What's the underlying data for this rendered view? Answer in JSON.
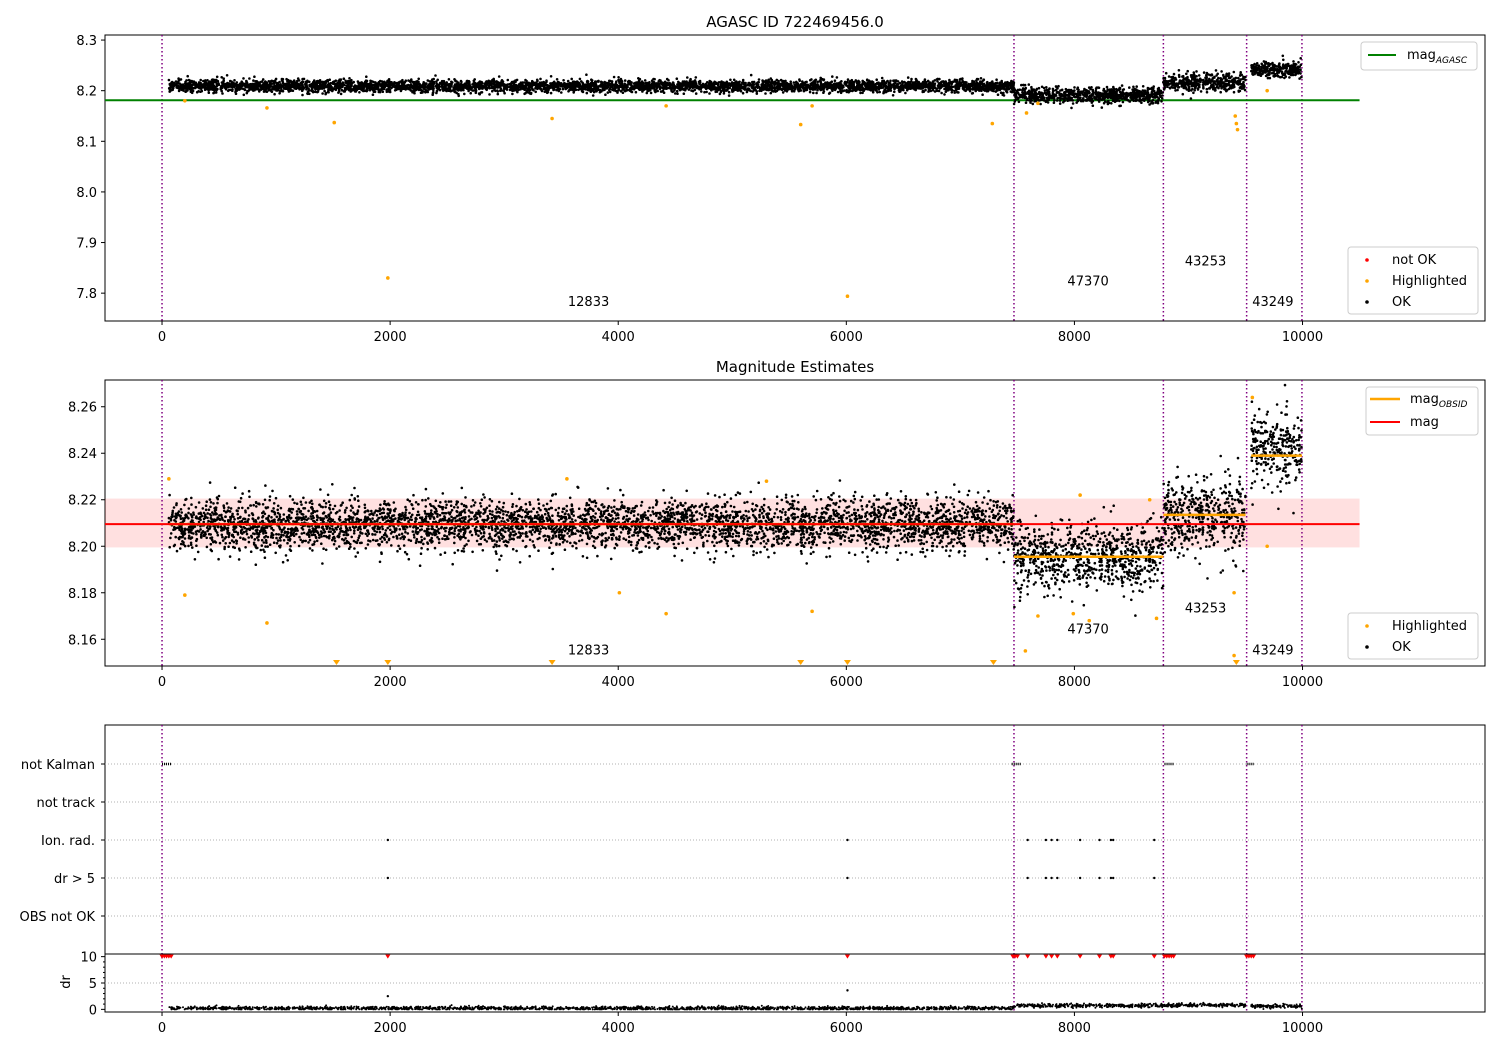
{
  "chart_data": [
    {
      "type": "scatter",
      "title": "AGASC ID 722469456.0",
      "xlim": [
        -500,
        11600
      ],
      "ylim": [
        7.745,
        8.31
      ],
      "xticks": [
        0,
        2000,
        4000,
        6000,
        8000,
        10000
      ],
      "yticks": [
        7.8,
        7.9,
        8.0,
        8.1,
        8.2,
        8.3
      ],
      "obs_boundaries": [
        0,
        7470,
        8780,
        9510,
        9995
      ],
      "obs_labels": [
        {
          "text": "12833",
          "x": 3740,
          "y": 7.775
        },
        {
          "text": "47370",
          "x": 8120,
          "y": 7.815
        },
        {
          "text": "43253",
          "x": 9150,
          "y": 7.855
        },
        {
          "text": "43249",
          "x": 9740,
          "y": 7.775
        }
      ],
      "reference_lines": [
        {
          "name": "mag_AGASC",
          "y": 8.181,
          "x": [
            -500,
            10500
          ],
          "color": "#008000"
        }
      ],
      "bands": [
        {
          "x": [
            60,
            7470
          ],
          "center": 8.209,
          "spread": 0.006
        },
        {
          "x": [
            7470,
            8780
          ],
          "center": 8.191,
          "spread": 0.008
        },
        {
          "x": [
            8780,
            9500
          ],
          "center": 8.216,
          "spread": 0.009
        },
        {
          "x": [
            9550,
            9995
          ],
          "center": 8.242,
          "spread": 0.008
        }
      ],
      "highlighted_points": [
        [
          1510,
          8.137
        ],
        [
          1980,
          7.83
        ],
        [
          3420,
          8.145
        ],
        [
          5600,
          8.133
        ],
        [
          6010,
          7.794
        ],
        [
          7280,
          8.135
        ],
        [
          7580,
          8.156
        ],
        [
          7680,
          8.175
        ],
        [
          9410,
          8.15
        ],
        [
          9420,
          8.135
        ],
        [
          9430,
          8.123
        ],
        [
          9690,
          8.2
        ],
        [
          200,
          8.18
        ],
        [
          920,
          8.166
        ],
        [
          4420,
          8.17
        ],
        [
          5700,
          8.17
        ]
      ],
      "legend": [
        "not OK",
        "Highlighted",
        "OK"
      ],
      "legend_top": [
        "mag_AGASC"
      ],
      "colors": {
        "ok": "#000000",
        "highlighted": "#ffa500",
        "not_ok": "#ff0000",
        "agasc_line": "#008000"
      }
    },
    {
      "type": "scatter",
      "title": "Magnitude Estimates",
      "xlim": [
        -500,
        11600
      ],
      "ylim": [
        8.1485,
        8.2715
      ],
      "xticks": [
        0,
        2000,
        4000,
        6000,
        8000,
        10000
      ],
      "yticks": [
        8.16,
        8.18,
        8.2,
        8.22,
        8.24,
        8.26
      ],
      "obs_boundaries": [
        0,
        7470,
        8780,
        9510,
        9995
      ],
      "obs_labels": [
        {
          "text": "12833",
          "x": 3740,
          "y": 8.1535
        },
        {
          "text": "47370",
          "x": 8120,
          "y": 8.1625
        },
        {
          "text": "43253",
          "x": 9150,
          "y": 8.1715
        },
        {
          "text": "43249",
          "x": 9740,
          "y": 8.1535
        }
      ],
      "mag": {
        "y": 8.2095,
        "x": [
          -500,
          10500
        ],
        "band": [
          8.1995,
          8.2205
        ],
        "color": "#ff0000"
      },
      "mag_obsid": [
        {
          "x": [
            60,
            7470
          ],
          "y": 8.2095
        },
        {
          "x": [
            7470,
            8780
          ],
          "y": 8.1955
        },
        {
          "x": [
            8780,
            9500
          ],
          "y": 8.2135
        },
        {
          "x": [
            9550,
            9995
          ],
          "y": 8.239
        }
      ],
      "bands": [
        {
          "x": [
            60,
            7470
          ],
          "center": 8.2095,
          "spread": 0.0055
        },
        {
          "x": [
            7470,
            8780
          ],
          "center": 8.1955,
          "spread": 0.0075
        },
        {
          "x": [
            8780,
            9500
          ],
          "center": 8.2135,
          "spread": 0.0085
        },
        {
          "x": [
            9550,
            9995
          ],
          "center": 8.241,
          "spread": 0.0075
        }
      ],
      "highlighted_points": [
        [
          200,
          8.179
        ],
        [
          920,
          8.167
        ],
        [
          4010,
          8.18
        ],
        [
          4420,
          8.171
        ],
        [
          5700,
          8.172
        ],
        [
          7570,
          8.155
        ],
        [
          7680,
          8.17
        ],
        [
          7990,
          8.171
        ],
        [
          8130,
          8.168
        ],
        [
          8720,
          8.169
        ],
        [
          9400,
          8.18
        ],
        [
          9400,
          8.153
        ],
        [
          9690,
          8.2
        ],
        [
          9560,
          8.264
        ],
        [
          60,
          8.229
        ],
        [
          3550,
          8.229
        ],
        [
          5300,
          8.228
        ],
        [
          8050,
          8.222
        ],
        [
          8660,
          8.22
        ]
      ],
      "clipped_points": [
        1530,
        1980,
        3420,
        5600,
        6010,
        7290,
        9420
      ],
      "legend": [
        "Highlighted",
        "OK"
      ],
      "legend_top": [
        "mag_OBSID",
        "mag"
      ],
      "colors": {
        "ok": "#000000",
        "highlighted": "#ffa500",
        "mag": "#ff0000",
        "mag_obsid": "#ffa500",
        "band": "#ff0000"
      }
    },
    {
      "type": "scatter",
      "title": "",
      "xlim": [
        -500,
        11600
      ],
      "flag_rows": [
        "not Kalman",
        "not track",
        "Ion. rad.",
        "dr > 5",
        "OBS not OK"
      ],
      "obs_boundaries": [
        0,
        7470,
        8780,
        9510,
        9995
      ],
      "flag_points": {
        "not Kalman": [
          [
            0,
            80
          ],
          [
            7450,
            7530
          ],
          [
            8790,
            8870
          ],
          [
            9510,
            9580
          ]
        ],
        "Ion. rad.": [
          1980,
          6010,
          7590,
          7750,
          7800,
          7850,
          8050,
          8220,
          8320,
          8340,
          8700
        ],
        "dr > 5": [
          1980,
          6010,
          7590,
          7750,
          7800,
          7850,
          8050,
          8220,
          8320,
          8340,
          8700
        ]
      },
      "dr": {
        "ylabel": "dr",
        "ylim": [
          -0.5,
          10.5
        ],
        "yticks": [
          0,
          5,
          10
        ],
        "clipped_x": [
          0,
          20,
          40,
          60,
          80,
          1980,
          6010,
          7460,
          7480,
          7500,
          7590,
          7750,
          7800,
          7850,
          8050,
          8220,
          8320,
          8340,
          8700,
          8790,
          8810,
          8830,
          8850,
          8870,
          9510,
          9530,
          9550,
          9570
        ],
        "outliers": [
          [
            1980,
            2.5
          ],
          [
            6010,
            3.6
          ]
        ],
        "baseline": [
          {
            "x": [
              60,
              7470
            ],
            "level": 0.2
          },
          {
            "x": [
              7470,
              8780
            ],
            "level": 0.7
          },
          {
            "x": [
              8780,
              9500
            ],
            "level": 0.8
          },
          {
            "x": [
              9550,
              9995
            ],
            "level": 0.6
          }
        ]
      },
      "colors": {
        "ok": "#000000",
        "clipped": "#ff0000"
      }
    }
  ]
}
